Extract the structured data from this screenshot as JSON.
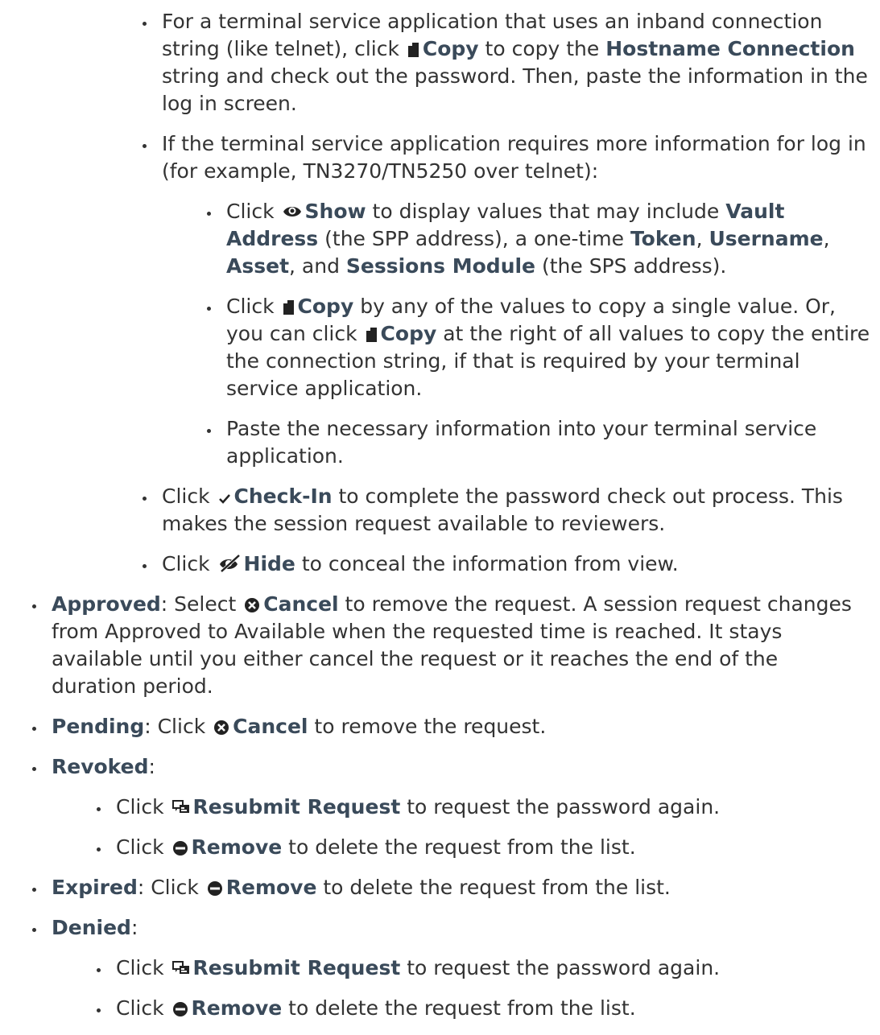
{
  "available_sub": [
    {
      "p1": "For a terminal service application that uses an inband connection string (like telnet), click ",
      "btn": "Copy",
      "p2": " to copy the ",
      "b1": "Hostname Connection",
      "p3": " string and check out the password. Then, paste the information in the log in screen."
    },
    {
      "intro": "If the terminal service application requires more information for log in (for example, TN3270/TN5250 over telnet):",
      "sub": [
        {
          "p1": "Click ",
          "btn": "Show",
          "p2": " to display values that may include ",
          "b1": "Vault Address",
          "p3": " (the SPP address), a one-time ",
          "b2": "Token",
          "p4": ", ",
          "b3": "Username",
          "p5": ", ",
          "b4": "Asset",
          "p6": ", and ",
          "b5": "Sessions Module",
          "p7": " (the SPS address)."
        },
        {
          "p1": "Click ",
          "btn": "Copy",
          "p2": " by any of the values to copy a single value. Or, you can click ",
          "btn2": "Copy",
          "p3": " at the right of all values to copy the entire the connection string, if that is required by your terminal service application."
        },
        {
          "text": "Paste the necessary information into your terminal service application."
        }
      ]
    },
    {
      "p1": "Click ",
      "btn": "Check-In",
      "p2": " to complete the password check out process. This makes the session request available to reviewers."
    },
    {
      "p1": "Click ",
      "btn": "Hide",
      "p2": " to conceal the information from view."
    }
  ],
  "approved": {
    "label": "Approved",
    "p1": ": Select ",
    "btn": "Cancel",
    "p2": " to remove the request. A session request changes from Approved to Available when the requested time is reached. It stays available until you either cancel the request or it reaches the end of the duration period."
  },
  "pending": {
    "label": "Pending",
    "p1": ": Click ",
    "btn": "Cancel",
    "p2": " to remove the request."
  },
  "revoked": {
    "label": "Revoked",
    "colon": ":",
    "sub": [
      {
        "p1": "Click ",
        "btn": "Resubmit Request",
        "p2": " to request the password again."
      },
      {
        "p1": "Click ",
        "btn": "Remove",
        "p2": " to delete the request from the list."
      }
    ]
  },
  "expired": {
    "label": "Expired",
    "p1": ": Click ",
    "btn": "Remove",
    "p2": " to delete the request from the list."
  },
  "denied": {
    "label": "Denied",
    "colon": ":",
    "sub": [
      {
        "p1": "Click ",
        "btn": "Resubmit Request",
        "p2": " to request the password again."
      },
      {
        "p1": "Click ",
        "btn": "Remove",
        "p2": " to delete the request from the list."
      }
    ]
  },
  "icons": {
    "copy": "copy-icon",
    "show": "eye-icon",
    "check_in": "checkmark-icon",
    "hide": "eye-slash-icon",
    "cancel": "cancel-circle-icon",
    "resubmit": "resubmit-icon",
    "remove": "remove-circle-icon"
  },
  "colors": {
    "text": "#333333",
    "bold": "#3a4a5a"
  }
}
